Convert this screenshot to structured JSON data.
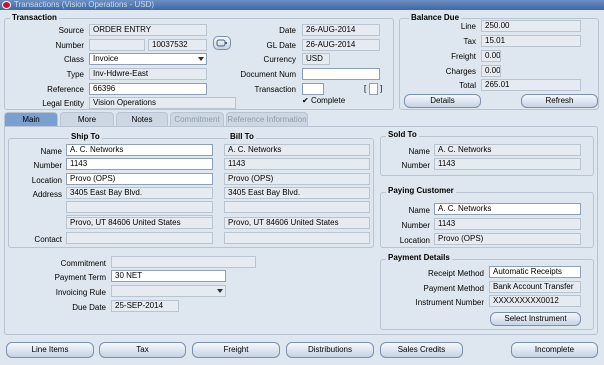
{
  "window": {
    "title": "Transactions (Vision Operations - USD)"
  },
  "transaction": {
    "section_label": "Transaction",
    "source_label": "Source",
    "source": "ORDER ENTRY",
    "number_label": "Number",
    "number": "10037532",
    "class_label": "Class",
    "class": "Invoice",
    "type_label": "Type",
    "type": "Inv-Hdwre-East",
    "reference_label": "Reference",
    "reference": "66396",
    "legal_entity_label": "Legal Entity",
    "legal_entity": "Vision Operations",
    "date_label": "Date",
    "date": "26-AUG-2014",
    "gl_date_label": "GL Date",
    "gl_date": "26-AUG-2014",
    "currency_label": "Currency",
    "currency": "USD",
    "document_num_label": "Document Num",
    "document_num": "",
    "transaction_label": "Transaction",
    "transaction_value": "",
    "bracket_open": "[",
    "bracket_close": "]",
    "complete_label": "Complete",
    "complete_checked": true
  },
  "balance_due": {
    "section_label": "Balance Due",
    "line_label": "Line",
    "line": "250.00",
    "tax_label": "Tax",
    "tax": "15.01",
    "freight_label": "Freight",
    "freight": "0.00",
    "charges_label": "Charges",
    "charges": "0.00",
    "total_label": "Total",
    "total": "265.01",
    "details_button": "Details",
    "refresh_button": "Refresh"
  },
  "tabs": [
    {
      "label": "Main",
      "state": "active"
    },
    {
      "label": "More",
      "state": "normal"
    },
    {
      "label": "Notes",
      "state": "normal"
    },
    {
      "label": "Commitment",
      "state": "disabled"
    },
    {
      "label": "Reference Information",
      "state": "disabled"
    }
  ],
  "ship_to": {
    "section_label": "Ship To",
    "name_label": "Name",
    "name": "A. C. Networks",
    "number_label": "Number",
    "number": "1143",
    "location_label": "Location",
    "location": "Provo (OPS)",
    "address_label": "Address",
    "address_lines": [
      "3405 East Bay Blvd.",
      "",
      "",
      "Provo, UT 84606 United States"
    ],
    "contact_label": "Contact",
    "contact": ""
  },
  "bill_to": {
    "section_label": "Bill To",
    "name": "A. C. Networks",
    "number": "1143",
    "location": "Provo (OPS)",
    "address_lines": [
      "3405 East Bay Blvd.",
      "",
      "",
      "Provo, UT 84606 United States"
    ],
    "contact": ""
  },
  "sold_to": {
    "section_label": "Sold To",
    "name_label": "Name",
    "name": "A. C. Networks",
    "number_label": "Number",
    "number": "1143"
  },
  "paying_customer": {
    "section_label": "Paying Customer",
    "name_label": "Name",
    "name": "A. C. Networks",
    "number_label": "Number",
    "number": "1143",
    "location_label": "Location",
    "location": "Provo (OPS)"
  },
  "terms": {
    "commitment_label": "Commitment",
    "commitment": "",
    "payment_term_label": "Payment Term",
    "payment_term": "30 NET",
    "invoicing_rule_label": "Invoicing Rule",
    "invoicing_rule": "",
    "due_date_label": "Due Date",
    "due_date": "25-SEP-2014"
  },
  "payment_details": {
    "section_label": "Payment Details",
    "receipt_method_label": "Receipt Method",
    "receipt_method": "Automatic Receipts",
    "payment_method_label": "Payment Method",
    "payment_method": "Bank Account Transfer",
    "instrument_number_label": "Instrument Number",
    "instrument_number": "XXXXXXXXX0012",
    "select_instrument_button": "Select Instrument"
  },
  "bottom_buttons": {
    "line_items": "Line Items",
    "tax": "Tax",
    "freight": "Freight",
    "distributions": "Distributions",
    "sales_credits": "Sales Credits",
    "incomplete": "Incomplete"
  }
}
